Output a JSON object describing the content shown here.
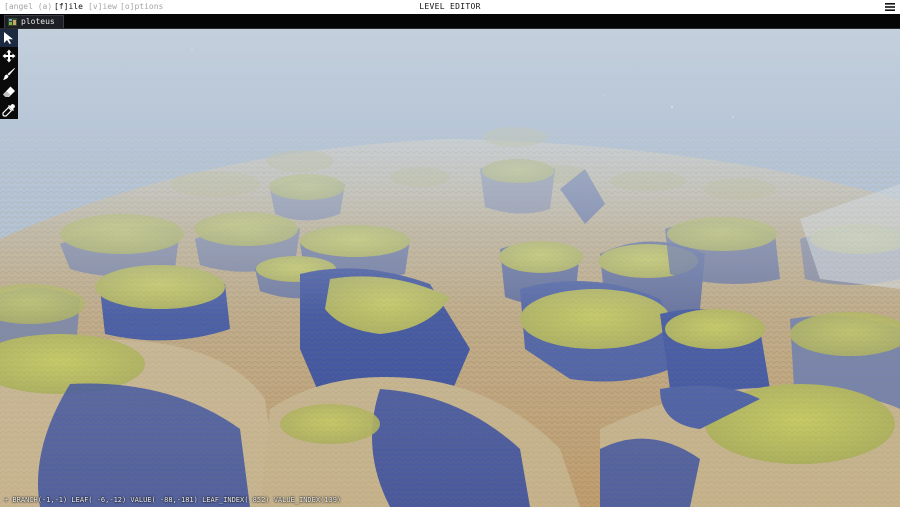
{
  "menubar": {
    "angel_label": "[angel (a)",
    "file_label": "[f]ile",
    "view_label": "[v]iew",
    "options_label": "[o]ptions",
    "title": "LEVEL EDITOR"
  },
  "tabs": [
    {
      "label": "ploteus",
      "icon": "terrain-file-icon"
    }
  ],
  "tools": [
    {
      "name": "select-tool",
      "icon": "arrow-cursor-icon",
      "active": true
    },
    {
      "name": "move-tool",
      "icon": "move-arrows-icon",
      "active": false
    },
    {
      "name": "brush-tool",
      "icon": "brush-icon",
      "active": false
    },
    {
      "name": "eraser-tool",
      "icon": "eraser-icon",
      "active": false
    },
    {
      "name": "eyedropper-tool",
      "icon": "eyedropper-icon",
      "active": false
    }
  ],
  "status": {
    "text": "+ BRANCH(-1,-1) LEAF( -6,-12) VALUE( -88,-181) LEAF_INDEX( 852) VALUE_INDEX(139)"
  },
  "colors": {
    "sky_top": "#8aa3c6",
    "sky_haze": "#c2cfd9",
    "terrain_sand": "#c9b48a",
    "terrain_grass": "#b9c15a",
    "terrain_shadow": "#4d5f9a",
    "active_tool_bg": "#1b2a40"
  }
}
